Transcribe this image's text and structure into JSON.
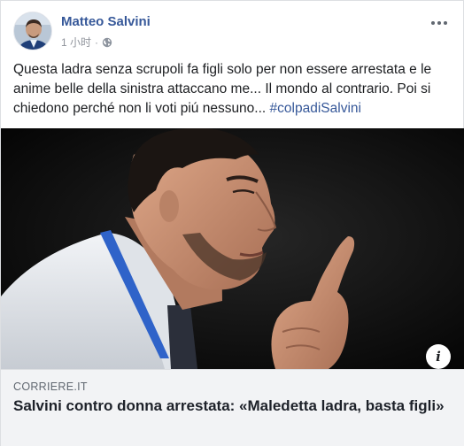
{
  "post": {
    "author": "Matteo Salvini",
    "time": "1 小时",
    "separator": "·",
    "text": "Questa ladra senza scrupoli fa figli solo per non essere arrestata e le anime belle della sinistra attaccano me... Il mondo al contrario. Poi si chiedono perché non li voti piú nessuno...",
    "hashtag": "#colpadiSalvini"
  },
  "link": {
    "domain": "CORRIERE.IT",
    "title": "Salvini contro donna arrestata: «Maledetta ladra, basta figli»",
    "info_glyph": "i"
  },
  "icons": {
    "privacy": "globe-icon",
    "more": "more-options-icon"
  },
  "colors": {
    "author": "#365899",
    "hashtag": "#365899",
    "meta": "#90949c",
    "preview_bg": "#f2f3f5"
  }
}
